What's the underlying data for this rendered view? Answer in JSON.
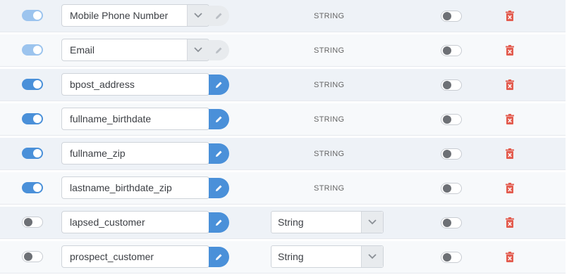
{
  "colors": {
    "accent": "#4a90d9",
    "accent_light": "#9cc4ee",
    "delete": "#e35c4f"
  },
  "rows": [
    {
      "name": "Mobile Phone Number",
      "mode": "dropdown",
      "toggle": "on-light",
      "type_text": "STRING",
      "secondary_toggle": "off"
    },
    {
      "name": "Email",
      "mode": "dropdown",
      "toggle": "on-light",
      "type_text": "STRING",
      "secondary_toggle": "off"
    },
    {
      "name": "bpost_address",
      "mode": "edit",
      "toggle": "on",
      "type_text": "STRING",
      "secondary_toggle": "off"
    },
    {
      "name": "fullname_birthdate",
      "mode": "edit",
      "toggle": "on",
      "type_text": "STRING",
      "secondary_toggle": "off"
    },
    {
      "name": "fullname_zip",
      "mode": "edit",
      "toggle": "on",
      "type_text": "STRING",
      "secondary_toggle": "off"
    },
    {
      "name": "lastname_birthdate_zip",
      "mode": "edit",
      "toggle": "on",
      "type_text": "STRING",
      "secondary_toggle": "off"
    },
    {
      "name": "lapsed_customer",
      "mode": "edit",
      "toggle": "off",
      "type_select": "String",
      "secondary_toggle": "off"
    },
    {
      "name": "prospect_customer",
      "mode": "edit",
      "toggle": "off",
      "type_select": "String",
      "secondary_toggle": "off"
    }
  ]
}
